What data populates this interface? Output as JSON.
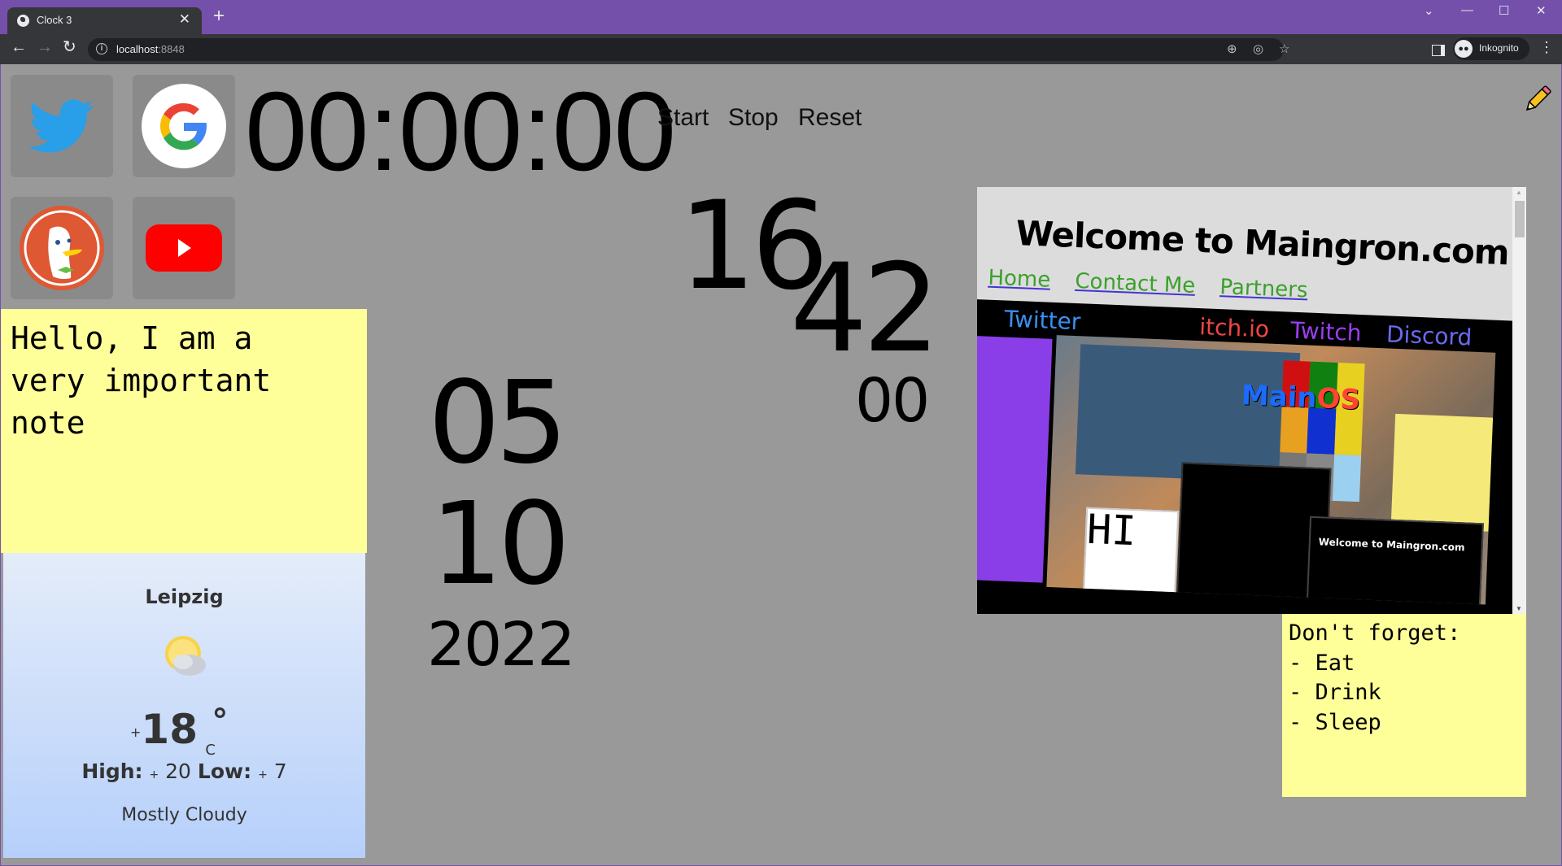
{
  "browser": {
    "tab_title": "Clock 3",
    "tab_icon": "globe-icon",
    "new_tab_label": "+",
    "url_host": "localhost",
    "url_port": ":8848",
    "profile_label": "Inkognito",
    "icons": {
      "back": "←",
      "forward": "→",
      "reload": "↻",
      "info": "i",
      "zoom": "⊕",
      "eye_off": "◎",
      "star": "☆",
      "menu": "⋮",
      "close_tab": "✕",
      "tab_search": "⌄",
      "minimize": "—",
      "maximize": "☐",
      "close_window": "✕",
      "incognito": "🕶"
    },
    "colors": {
      "frame": "#7450ab",
      "toolbar": "#35363a",
      "omnibox": "#202124"
    }
  },
  "shortcuts": [
    {
      "name": "Twitter",
      "icon": "twitter-icon"
    },
    {
      "name": "Google",
      "icon": "google-icon"
    },
    {
      "name": "DuckDuckGo",
      "icon": "duckduckgo-icon"
    },
    {
      "name": "YouTube",
      "icon": "youtube-icon"
    }
  ],
  "stopwatch": {
    "display": "00:00:00",
    "start_label": "Start",
    "stop_label": "Stop",
    "reset_label": "Reset"
  },
  "clock": {
    "hours": "16",
    "minutes": "42",
    "seconds": "00"
  },
  "date": {
    "day": "05",
    "month": "10",
    "year": "2022"
  },
  "notes": [
    {
      "text": "Hello, I am a\nvery important\nnote"
    },
    {
      "text": "Don't forget:\n- Eat\n- Drink\n- Sleep"
    }
  ],
  "weather": {
    "city": "Leipzig",
    "icon": "partly-cloudy-icon",
    "temp_sign": "+",
    "temp": "18",
    "degree": "°",
    "unit": "C",
    "high_label": "High:",
    "high_sign": "+",
    "high": "20",
    "low_label": "Low:",
    "low_sign": "+",
    "low": "7",
    "condition": "Mostly Cloudy"
  },
  "embedded_site": {
    "heading": "Welcome to Maingron.com",
    "nav": [
      "Home",
      "Contact Me",
      "Partners"
    ],
    "social": [
      {
        "label": "Twitter",
        "color": "#3a8ef0"
      },
      {
        "label": "itch.io",
        "color": "#f04545"
      },
      {
        "label": "Twitch",
        "color": "#9a3ef0"
      },
      {
        "label": "Discord",
        "color": "#6a6af0"
      }
    ],
    "screenshot_title": "Main",
    "screenshot_title_accent": "OS",
    "paint_text": "HI",
    "mini_heading": "Welcome to Maingron.com"
  },
  "edit_button": {
    "icon": "pencil-icon"
  }
}
